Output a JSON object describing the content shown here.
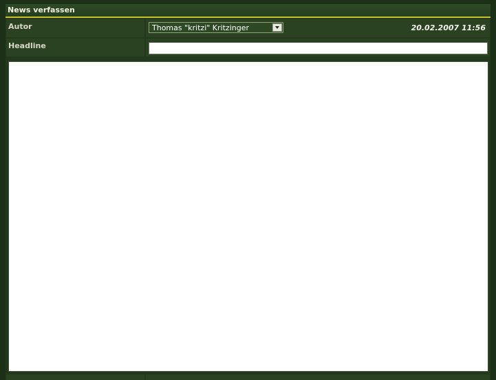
{
  "panel": {
    "title": "News verfassen"
  },
  "form": {
    "autor": {
      "label": "Autor",
      "selected": "Thomas \"kritzi\" Kritzinger"
    },
    "datetime": "20.02.2007 11:56",
    "headline": {
      "label": "Headline",
      "value": ""
    },
    "body": {
      "value": ""
    }
  },
  "colors": {
    "background": "#1c3018",
    "panel": "#23381d",
    "accent_line": "#c8c22a"
  },
  "icons": {
    "select_arrow": "chevron-down-icon"
  }
}
